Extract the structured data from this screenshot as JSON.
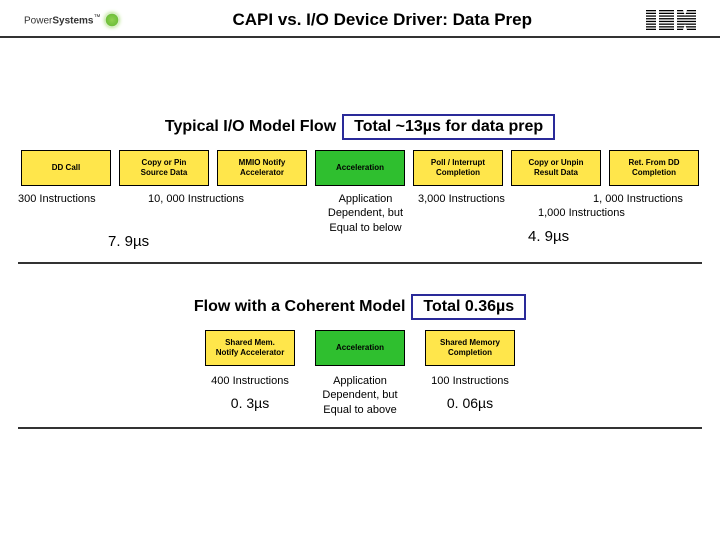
{
  "header": {
    "ps_word1": "Power",
    "ps_word2": "Systems",
    "ps_tm": "™",
    "title": "CAPI vs. I/O Device Driver: Data Prep",
    "logo_alt": "IBM"
  },
  "top": {
    "label": "Typical I/O Model Flow",
    "total": "Total ~13µs for data prep",
    "boxes": {
      "b1": "DD Call",
      "b2": "Copy or Pin\nSource Data",
      "b3": "MMIO Notify\nAccelerator",
      "b4": "Acceleration",
      "b5": "Poll / Interrupt\nCompletion",
      "b6": "Copy or Unpin\nResult Data",
      "b7": "Ret. From DD\nCompletion"
    },
    "ann": {
      "a1": "300 Instructions",
      "a2": "10, 000 Instructions",
      "a4a": "Application",
      "a4b": "Dependent, but",
      "a4c": "Equal to below",
      "a5": "3,000 Instructions",
      "a6": "1,000 Instructions",
      "a7": "1, 000 Instructions",
      "t_left": "7. 9µs",
      "t_right": "4. 9µs"
    }
  },
  "bottom": {
    "label": "Flow with a Coherent Model",
    "total": "Total 0.36µs",
    "boxes": {
      "b1": "Shared Mem.\nNotify Accelerator",
      "b2": "Acceleration",
      "b3": "Shared Memory\nCompletion"
    },
    "ann": {
      "a1": "400 Instructions",
      "a2a": "Application",
      "a2b": "Dependent, but",
      "a2c": "Equal to above",
      "a3": "100 Instructions",
      "t1": "0. 3µs",
      "t3": "0. 06µs"
    }
  }
}
